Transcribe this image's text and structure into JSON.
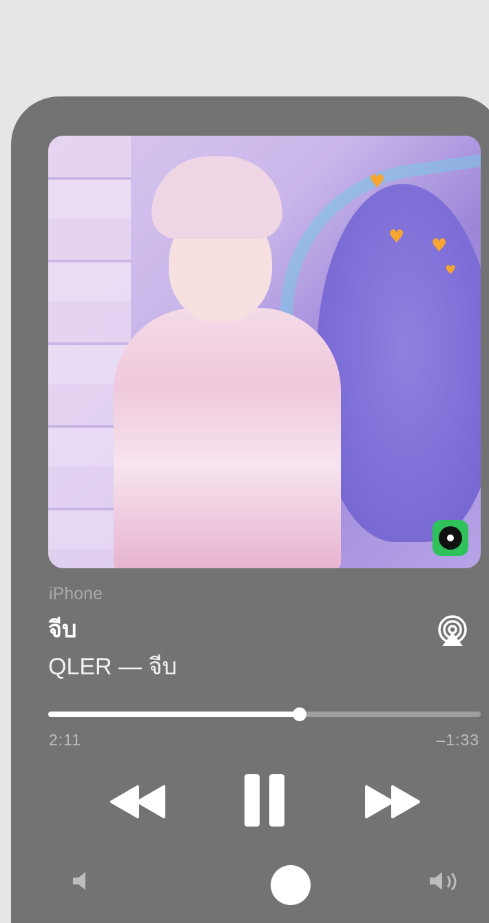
{
  "now_playing": {
    "device": "iPhone",
    "title": "จีบ",
    "artist_line": "QLER — จีบ"
  },
  "playback": {
    "elapsed": "2:11",
    "remaining": "–1:33",
    "progress_fraction": 0.582
  },
  "controls": {
    "rewind_icon": "backward-icon",
    "pause_icon": "pause-icon",
    "forward_icon": "forward-icon",
    "airplay_icon": "airplay-icon"
  },
  "artwork": {
    "badge_icon": "music-app-icon",
    "accent": "#2fc25b"
  },
  "colors": {
    "panel": "#737373",
    "background": "#e6e6e6"
  }
}
